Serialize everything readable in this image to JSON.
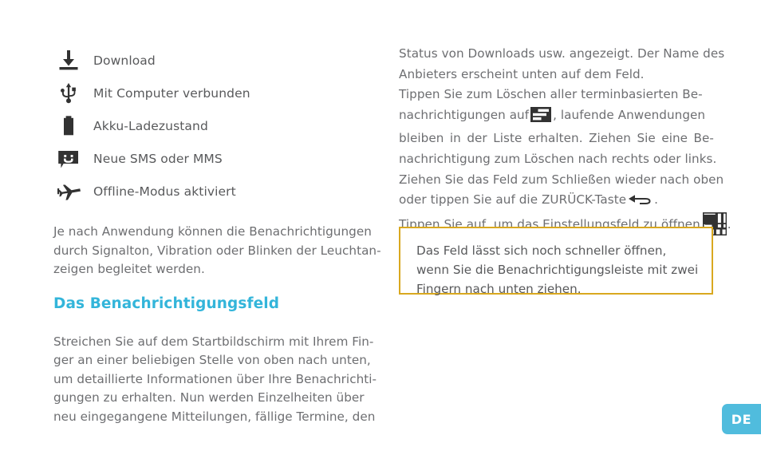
{
  "page": {
    "language_badge": "DE",
    "colors": {
      "heading": "#33b5da",
      "badge": "#50bcdd",
      "tip_border": "#d9a81f",
      "body_text": "#6d6e71",
      "icon_ink": "#323232"
    }
  },
  "legend": {
    "items": [
      {
        "icon": "download-icon",
        "label": "Download"
      },
      {
        "icon": "usb-icon",
        "label": "Mit Computer verbunden"
      },
      {
        "icon": "battery-icon",
        "label": "Akku-Ladezustand"
      },
      {
        "icon": "sms-message-icon",
        "label": "Neue SMS oder MMS"
      },
      {
        "icon": "airplane-mode-icon",
        "label": "Offline-Modus aktiviert"
      }
    ]
  },
  "left_column": {
    "paragraph_1": {
      "lines": [
        "Je nach Anwendung können die Benachrichtigungen",
        "durch Signalton, Vibration oder Blinken der Leuchtan-",
        "zeigen begleitet werden."
      ]
    },
    "heading": "Das Benachrichtigungsfeld",
    "paragraph_2": {
      "lines": [
        "Streichen Sie auf dem Startbildschirm mit Ihrem Fin-",
        "ger an einer beliebigen Stelle von oben nach unten,",
        "um detaillierte Informationen über Ihre Benachrichti-",
        "gungen zu erhalten. Nun werden Einzelheiten über",
        "neu eingegangene Mitteilungen, fällige Termine, den"
      ]
    }
  },
  "right_column": {
    "line_1": "Status von Downloads usw. angezeigt. Der Name des",
    "line_2": "Anbieters erscheint unten auf dem Feld.",
    "line_3": "Tippen Sie zum Löschen aller terminbasierten Be-",
    "line_4a": "nachrichtigungen auf",
    "line_4_icon": "clear-notifications-icon",
    "line_4b": ", laufende Anwendungen",
    "line_5": "bleiben in der Liste erhalten. Ziehen Sie eine Be-",
    "line_6": "nachrichtigung zum Löschen nach rechts oder links.",
    "line_7": "Ziehen Sie das Feld zum Schließen wieder nach oben",
    "line_8a": "oder tippen Sie auf die ZURÜCK-Taste",
    "line_8_icon": "back-arrow-icon",
    "line_8b": ".",
    "line_9a": "Tippen Sie auf, um das Einstellungsfeld zu öffnen",
    "line_9_icon": "settings-grid-icon",
    "line_9b": "."
  },
  "tip_box": {
    "lines": [
      "Das Feld lässt sich noch schneller öffnen,",
      "wenn Sie die Benachrichtigungsleiste mit zwei",
      "Fingern nach unten ziehen."
    ]
  }
}
